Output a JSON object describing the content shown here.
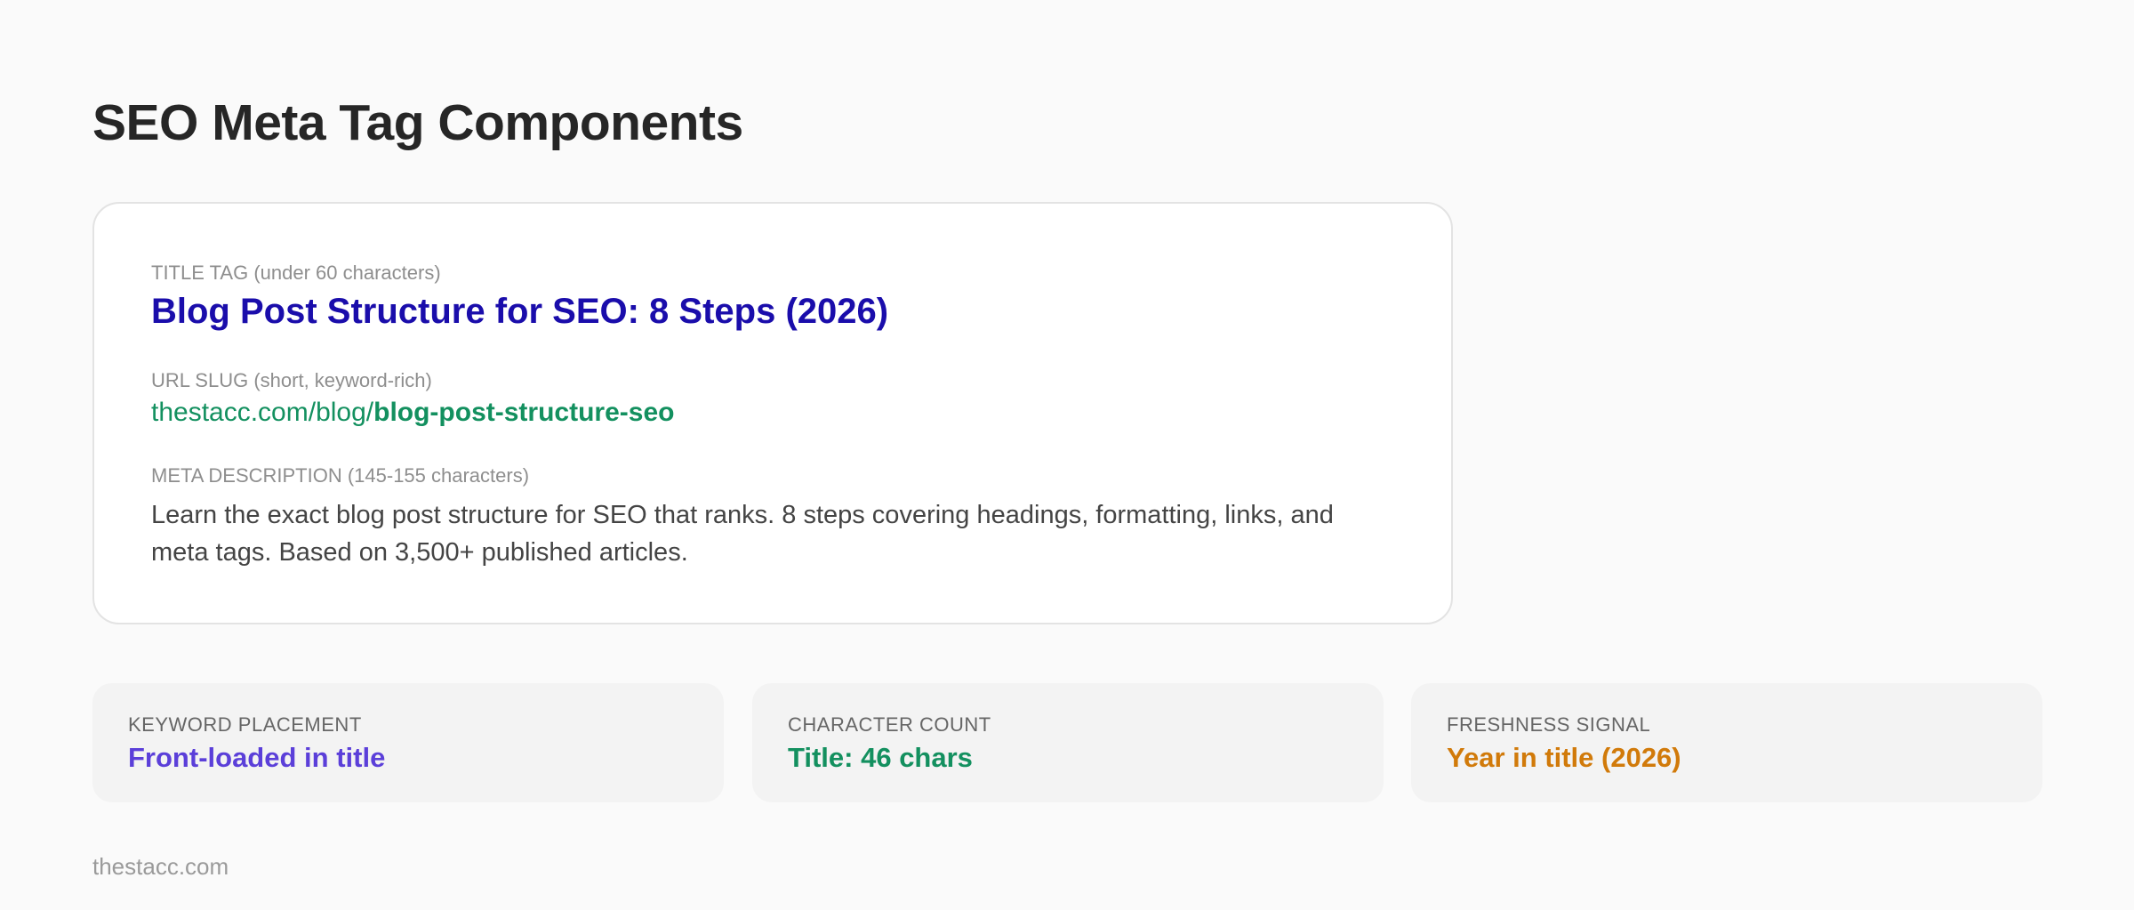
{
  "page": {
    "title": "SEO Meta Tag Components",
    "footer": "thestacc.com"
  },
  "meta_card": {
    "title_tag": {
      "label": "TITLE TAG (under 60 characters)",
      "value": "Blog Post Structure for SEO: 8 Steps (2026)"
    },
    "url_slug": {
      "label": "URL SLUG (short, keyword-rich)",
      "base": "thestacc.com/blog/",
      "slug": "blog-post-structure-seo"
    },
    "meta_description": {
      "label": "META DESCRIPTION (145-155 characters)",
      "value": "Learn the exact blog post structure for SEO that ranks. 8 steps covering headings, formatting, links, and meta tags. Based on 3,500+ published articles."
    }
  },
  "stats": [
    {
      "label": "KEYWORD PLACEMENT",
      "value": "Front-loaded in title",
      "color": "#5b3fd9"
    },
    {
      "label": "CHARACTER COUNT",
      "value": "Title: 46 chars",
      "color": "#13905f"
    },
    {
      "label": "FRESHNESS SIGNAL",
      "value": "Year in title (2026)",
      "color": "#d17a0a"
    }
  ],
  "colors": {
    "background": "#fafafa",
    "title_link": "#1a0dab",
    "url_green": "#13905f"
  }
}
